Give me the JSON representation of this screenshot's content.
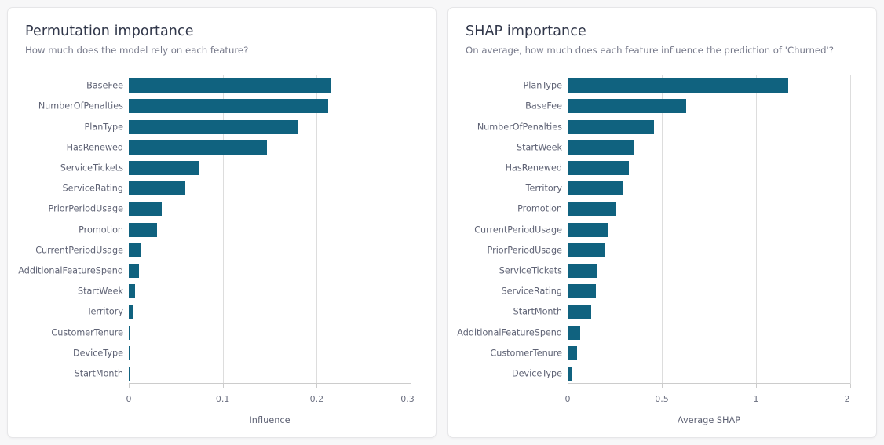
{
  "theme": {
    "page_background": "#f7f7f8",
    "card_background": "#ffffff",
    "card_border": "#e6e6e8",
    "bar_color": "#10627f",
    "title_color": "#31374a",
    "subtitle_color": "#76798a",
    "axis_label_color": "#6b6f80",
    "gridline_color": "#dddddd"
  },
  "cards": [
    {
      "id": "permutation-importance",
      "title": "Permutation importance",
      "subtitle": "How much does the model rely on each feature?"
    },
    {
      "id": "shap-importance",
      "title": "SHAP importance",
      "subtitle": "On average, how much does each feature influence the prediction of 'Churned'?"
    }
  ],
  "chart_data": [
    {
      "type": "bar",
      "orientation": "horizontal",
      "title": "Permutation importance",
      "subtitle": "How much does the model rely on each feature?",
      "xlabel": "Influence",
      "ylabel": "",
      "xlim": [
        0,
        0.3
      ],
      "xticks": [
        0,
        0.1,
        0.2,
        0.3
      ],
      "xticklabels": [
        "0",
        "0.1",
        "0.2",
        "0.3"
      ],
      "grid": true,
      "legend": false,
      "categories": [
        "BaseFee",
        "NumberOfPenalties",
        "PlanType",
        "HasRenewed",
        "ServiceTickets",
        "ServiceRating",
        "PriorPeriodUsage",
        "Promotion",
        "CurrentPeriodUsage",
        "AdditionalFeatureSpend",
        "StartWeek",
        "Territory",
        "CustomerTenure",
        "DeviceType",
        "StartMonth"
      ],
      "values": [
        0.216,
        0.212,
        0.18,
        0.147,
        0.075,
        0.06,
        0.035,
        0.03,
        0.013,
        0.011,
        0.007,
        0.004,
        0.002,
        0.0006,
        0.0004
      ]
    },
    {
      "type": "bar",
      "orientation": "horizontal",
      "title": "SHAP importance",
      "subtitle": "On average, how much does each feature influence the prediction of 'Churned'?",
      "xlabel": "Average SHAP",
      "ylabel": "",
      "xlim": [
        0,
        1.5
      ],
      "xticks": [
        0,
        0.5,
        1,
        1.5
      ],
      "xticklabels": [
        "0",
        "0.5",
        "1",
        "2"
      ],
      "grid": true,
      "legend": false,
      "categories": [
        "PlanType",
        "BaseFee",
        "NumberOfPenalties",
        "StartWeek",
        "HasRenewed",
        "Territory",
        "Promotion",
        "CurrentPeriodUsage",
        "PriorPeriodUsage",
        "ServiceTickets",
        "ServiceRating",
        "StartMonth",
        "AdditionalFeatureSpend",
        "CustomerTenure",
        "DeviceType"
      ],
      "values": [
        1.17,
        0.63,
        0.46,
        0.35,
        0.325,
        0.29,
        0.26,
        0.215,
        0.2,
        0.155,
        0.15,
        0.125,
        0.065,
        0.05,
        0.025
      ]
    }
  ]
}
